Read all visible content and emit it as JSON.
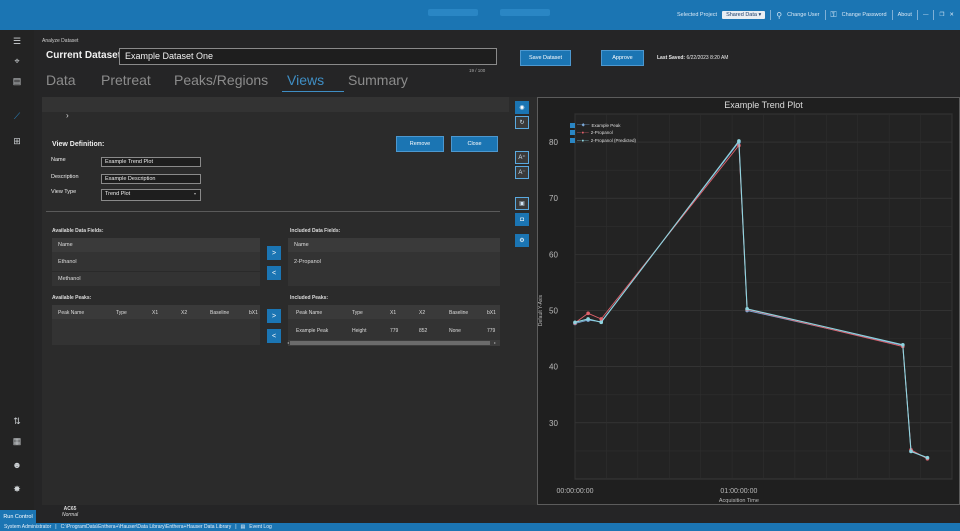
{
  "titlebar": {
    "project_label": "Selected Project",
    "project_value": "Shared Data",
    "change_user": "Change User",
    "change_password": "Change Password",
    "about": "About"
  },
  "header": {
    "breadcrumb": "Analyze Dataset",
    "current_dataset_label": "Current Dataset:",
    "dataset_name": "Example Dataset One",
    "char_count": "19 / 100",
    "save_label": "Save Dataset",
    "approve_label": "Approve",
    "last_saved_label": "Last Saved:",
    "last_saved_value": "6/22/2023 8:20 AM"
  },
  "tabs": [
    "Data",
    "Pretreat",
    "Peaks/Regions",
    "Views",
    "Summary"
  ],
  "active_tab": "Views",
  "view_def": {
    "title": "View Definition:",
    "remove_label": "Remove",
    "close_label": "Close",
    "name_label": "Name",
    "name_value": "Example Trend Plot",
    "desc_label": "Description",
    "desc_value": "Example Description",
    "type_label": "View Type",
    "type_value": "Trend Plot"
  },
  "available_fields": {
    "title": "Available Data Fields:",
    "header": "Name",
    "items": [
      "Ethanol",
      "Methanol"
    ]
  },
  "included_fields": {
    "title": "Included Data Fields:",
    "header": "Name",
    "items": [
      "2-Propanol"
    ]
  },
  "available_peaks": {
    "title": "Available Peaks:",
    "columns": [
      "Peak Name",
      "Type",
      "X1",
      "X2",
      "Baseline",
      "bX1"
    ]
  },
  "included_peaks": {
    "title": "Included Peaks:",
    "columns": [
      "Peak Name",
      "Type",
      "X1",
      "X2",
      "Baseline",
      "bX1"
    ],
    "rows": [
      [
        "Example Peak",
        "Height",
        "779",
        "852",
        "None",
        "779"
      ]
    ]
  },
  "arrows": {
    "add": ">",
    "remove": "<"
  },
  "status": {
    "run_control": "Run Control",
    "instrument": "AC65",
    "mode": "Normal",
    "user": "System Administrator",
    "path": "C:\\ProgramData\\Enthera+\\Hauser\\Data Library\\Enthera+Hauser Data Library",
    "event_log": "Event Log"
  },
  "colors": {
    "accent": "#1b75b3",
    "series_red": "#e0616b",
    "series_cyan": "#8fd4df",
    "series_blue": "#7ba8d8"
  },
  "chart_data": {
    "type": "line",
    "title": "Example Trend Plot",
    "xlabel": "Acquisition Time",
    "ylabel": "Default Y-Axis",
    "x_ticks": [
      "00:00:00:00",
      "01:00:00:00"
    ],
    "ylim": [
      20,
      85
    ],
    "y_ticks": [
      30,
      40,
      50,
      60,
      70,
      80
    ],
    "grid": true,
    "legend_position": "top-left",
    "series": [
      {
        "name": "Example Peak",
        "color": "#7ba8d8",
        "points": [
          [
            0.0,
            47.7
          ],
          [
            0.08,
            48.3
          ],
          [
            0.16,
            48.0
          ],
          [
            1.0,
            80.0
          ],
          [
            1.05,
            50.0
          ],
          [
            2.0,
            43.8
          ],
          [
            2.05,
            25.0
          ],
          [
            2.15,
            23.7
          ]
        ]
      },
      {
        "name": "2-Propanol",
        "color": "#e0616b",
        "points": [
          [
            0.0,
            47.8
          ],
          [
            0.08,
            49.5
          ],
          [
            0.16,
            48.5
          ],
          [
            1.0,
            79.4
          ],
          [
            1.05,
            50.2
          ],
          [
            2.0,
            43.6
          ],
          [
            2.05,
            25.2
          ],
          [
            2.15,
            23.6
          ]
        ]
      },
      {
        "name": "2-Propanol (Predicted)",
        "color": "#8fd4df",
        "points": [
          [
            0.0,
            47.9
          ],
          [
            0.08,
            48.5
          ],
          [
            0.16,
            47.9
          ],
          [
            1.0,
            80.2
          ],
          [
            1.05,
            50.3
          ],
          [
            2.0,
            43.9
          ],
          [
            2.05,
            24.9
          ],
          [
            2.15,
            23.8
          ]
        ]
      }
    ]
  }
}
